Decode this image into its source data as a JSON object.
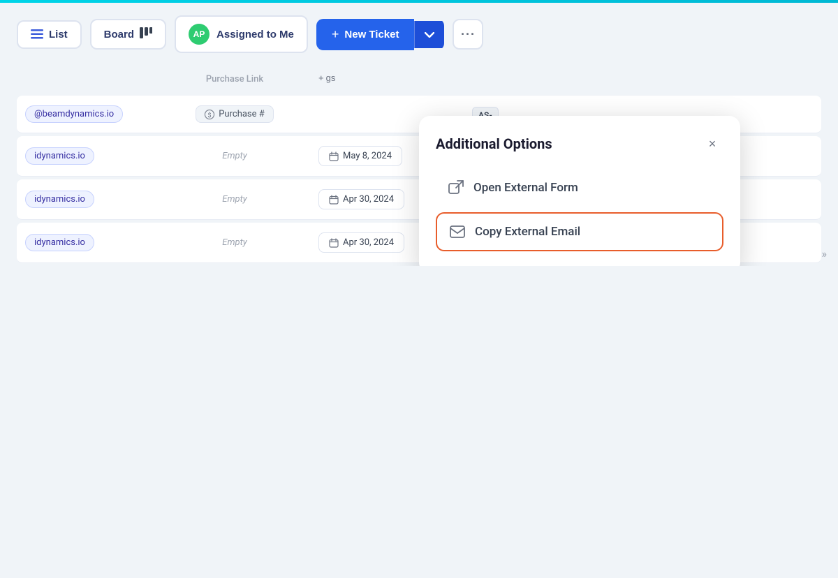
{
  "topbar": {
    "accent_color": "#00d4e8"
  },
  "toolbar": {
    "list_label": "List",
    "board_label": "Board",
    "assigned_label": "Assigned to Me",
    "avatar_text": "AP",
    "new_ticket_label": "New Ticket",
    "new_ticket_plus": "+",
    "more_icon": "···"
  },
  "popup": {
    "title": "Additional Options",
    "close_icon": "×",
    "items": [
      {
        "label": "Open External Form",
        "icon": "external-link-icon"
      },
      {
        "label": "Copy External Email",
        "icon": "email-icon",
        "highlighted": true
      }
    ]
  },
  "table": {
    "column_headers": {
      "purchase_link": "Purchase Link",
      "add_col": "+ gs"
    },
    "rows": [
      {
        "email": "@beamdynamics.io",
        "purchase": "Purchase #",
        "date": "",
        "extra": "AS-"
      },
      {
        "email": "idynamics.io",
        "purchase": "",
        "date": "May 8, 2024",
        "extra": ""
      },
      {
        "email": "idynamics.io",
        "purchase": "",
        "date": "Apr 30, 2024",
        "extra": ""
      },
      {
        "email": "idynamics.io",
        "purchase": "",
        "date": "Apr 30, 2024",
        "extra": ""
      }
    ],
    "empty_label": "Empty"
  },
  "icons": {
    "list": "☰",
    "board": "⊞",
    "chevron_down": "▾",
    "more": "•••",
    "expand": "»",
    "calendar": "📅",
    "external_link": "↗",
    "email": "✉",
    "dollar": "$"
  }
}
